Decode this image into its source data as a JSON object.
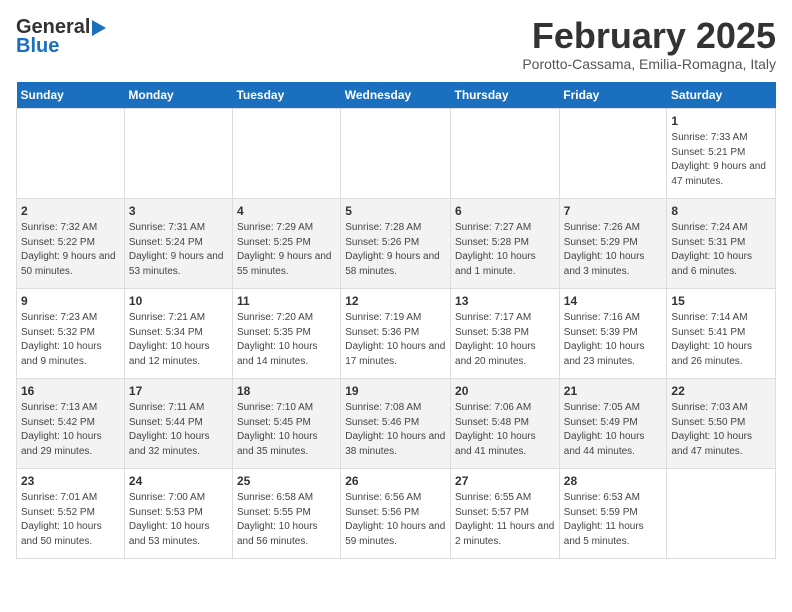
{
  "header": {
    "logo_line1": "General",
    "logo_line2": "Blue",
    "title": "February 2025",
    "subtitle": "Porotto-Cassama, Emilia-Romagna, Italy"
  },
  "days_of_week": [
    "Sunday",
    "Monday",
    "Tuesday",
    "Wednesday",
    "Thursday",
    "Friday",
    "Saturday"
  ],
  "weeks": [
    [
      {
        "num": "",
        "info": ""
      },
      {
        "num": "",
        "info": ""
      },
      {
        "num": "",
        "info": ""
      },
      {
        "num": "",
        "info": ""
      },
      {
        "num": "",
        "info": ""
      },
      {
        "num": "",
        "info": ""
      },
      {
        "num": "1",
        "info": "Sunrise: 7:33 AM\nSunset: 5:21 PM\nDaylight: 9 hours and 47 minutes."
      }
    ],
    [
      {
        "num": "2",
        "info": "Sunrise: 7:32 AM\nSunset: 5:22 PM\nDaylight: 9 hours and 50 minutes."
      },
      {
        "num": "3",
        "info": "Sunrise: 7:31 AM\nSunset: 5:24 PM\nDaylight: 9 hours and 53 minutes."
      },
      {
        "num": "4",
        "info": "Sunrise: 7:29 AM\nSunset: 5:25 PM\nDaylight: 9 hours and 55 minutes."
      },
      {
        "num": "5",
        "info": "Sunrise: 7:28 AM\nSunset: 5:26 PM\nDaylight: 9 hours and 58 minutes."
      },
      {
        "num": "6",
        "info": "Sunrise: 7:27 AM\nSunset: 5:28 PM\nDaylight: 10 hours and 1 minute."
      },
      {
        "num": "7",
        "info": "Sunrise: 7:26 AM\nSunset: 5:29 PM\nDaylight: 10 hours and 3 minutes."
      },
      {
        "num": "8",
        "info": "Sunrise: 7:24 AM\nSunset: 5:31 PM\nDaylight: 10 hours and 6 minutes."
      }
    ],
    [
      {
        "num": "9",
        "info": "Sunrise: 7:23 AM\nSunset: 5:32 PM\nDaylight: 10 hours and 9 minutes."
      },
      {
        "num": "10",
        "info": "Sunrise: 7:21 AM\nSunset: 5:34 PM\nDaylight: 10 hours and 12 minutes."
      },
      {
        "num": "11",
        "info": "Sunrise: 7:20 AM\nSunset: 5:35 PM\nDaylight: 10 hours and 14 minutes."
      },
      {
        "num": "12",
        "info": "Sunrise: 7:19 AM\nSunset: 5:36 PM\nDaylight: 10 hours and 17 minutes."
      },
      {
        "num": "13",
        "info": "Sunrise: 7:17 AM\nSunset: 5:38 PM\nDaylight: 10 hours and 20 minutes."
      },
      {
        "num": "14",
        "info": "Sunrise: 7:16 AM\nSunset: 5:39 PM\nDaylight: 10 hours and 23 minutes."
      },
      {
        "num": "15",
        "info": "Sunrise: 7:14 AM\nSunset: 5:41 PM\nDaylight: 10 hours and 26 minutes."
      }
    ],
    [
      {
        "num": "16",
        "info": "Sunrise: 7:13 AM\nSunset: 5:42 PM\nDaylight: 10 hours and 29 minutes."
      },
      {
        "num": "17",
        "info": "Sunrise: 7:11 AM\nSunset: 5:44 PM\nDaylight: 10 hours and 32 minutes."
      },
      {
        "num": "18",
        "info": "Sunrise: 7:10 AM\nSunset: 5:45 PM\nDaylight: 10 hours and 35 minutes."
      },
      {
        "num": "19",
        "info": "Sunrise: 7:08 AM\nSunset: 5:46 PM\nDaylight: 10 hours and 38 minutes."
      },
      {
        "num": "20",
        "info": "Sunrise: 7:06 AM\nSunset: 5:48 PM\nDaylight: 10 hours and 41 minutes."
      },
      {
        "num": "21",
        "info": "Sunrise: 7:05 AM\nSunset: 5:49 PM\nDaylight: 10 hours and 44 minutes."
      },
      {
        "num": "22",
        "info": "Sunrise: 7:03 AM\nSunset: 5:50 PM\nDaylight: 10 hours and 47 minutes."
      }
    ],
    [
      {
        "num": "23",
        "info": "Sunrise: 7:01 AM\nSunset: 5:52 PM\nDaylight: 10 hours and 50 minutes."
      },
      {
        "num": "24",
        "info": "Sunrise: 7:00 AM\nSunset: 5:53 PM\nDaylight: 10 hours and 53 minutes."
      },
      {
        "num": "25",
        "info": "Sunrise: 6:58 AM\nSunset: 5:55 PM\nDaylight: 10 hours and 56 minutes."
      },
      {
        "num": "26",
        "info": "Sunrise: 6:56 AM\nSunset: 5:56 PM\nDaylight: 10 hours and 59 minutes."
      },
      {
        "num": "27",
        "info": "Sunrise: 6:55 AM\nSunset: 5:57 PM\nDaylight: 11 hours and 2 minutes."
      },
      {
        "num": "28",
        "info": "Sunrise: 6:53 AM\nSunset: 5:59 PM\nDaylight: 11 hours and 5 minutes."
      },
      {
        "num": "",
        "info": ""
      }
    ]
  ]
}
